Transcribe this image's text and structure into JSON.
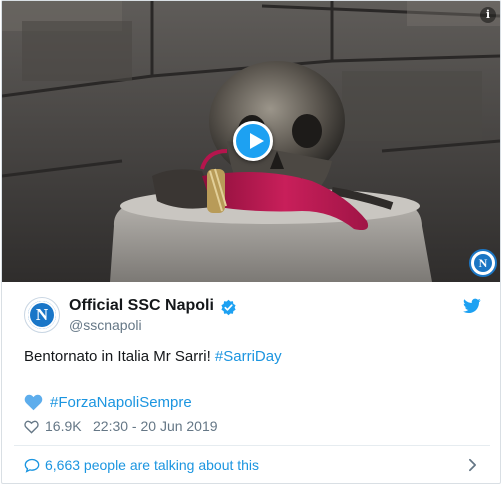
{
  "media": {
    "play_icon": "play-icon",
    "info_icon": "info-icon",
    "info_glyph": "i",
    "badge_glyph": "N"
  },
  "author": {
    "avatar_glyph": "N",
    "display_name": "Official SSC Napoli",
    "verified_icon": "verified-badge-icon",
    "handle": "@sscnapoli"
  },
  "brand_icon": "twitter-bird-icon",
  "tweet": {
    "text_plain": "Bentornato in Italia Mr Sarri! ",
    "hashtag_1": "#SarriDay",
    "heart_emoji": "blue-heart-icon",
    "hashtag_2": "#ForzaNapoliSempre"
  },
  "meta": {
    "like_icon": "heart-outline-icon",
    "likes": "16.9K",
    "timestamp": "22:30 - 20 Jun 2019"
  },
  "footer": {
    "talk_icon": "speech-bubble-icon",
    "talk_text": "6,663 people are talking about this",
    "chevron_icon": "chevron-right-icon"
  },
  "colors": {
    "accent": "#1da1f2",
    "link": "#1b95e0",
    "secondary_text": "#657786",
    "pepper_red": "#b5154d",
    "napoli_blue": "#1976c8"
  }
}
